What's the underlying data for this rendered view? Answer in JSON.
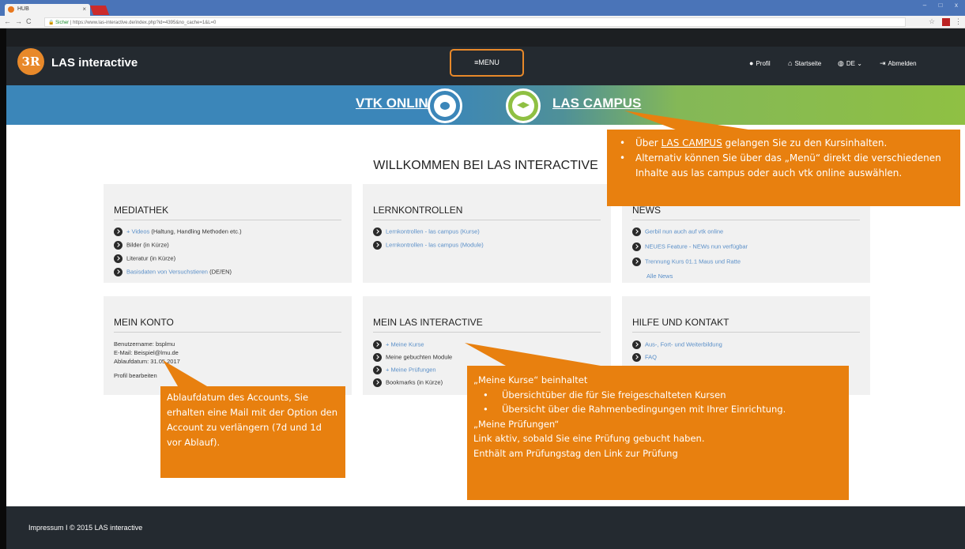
{
  "browser": {
    "tab_title": "HUB",
    "tab_close": "×",
    "url_secure": "Sicher",
    "url": "https://www.las-interactive.de/index.php?id=4395&no_cache=1&L=0",
    "star": "☆",
    "back": "←",
    "forward": "→",
    "reload": "C",
    "kebab": "⋮",
    "win_min": "–",
    "win_max": "□",
    "win_close": "x"
  },
  "header": {
    "logo_text": "3R",
    "brand": "LAS interactive",
    "menu_label": "≡MENU",
    "nav": {
      "profil": "Profil",
      "startseite": "Startseite",
      "lang": "DE",
      "abmelden": "Abmelden"
    }
  },
  "banner": {
    "vtk": "VTK ONLINE",
    "campus": "LAS CAMPUS"
  },
  "welcome": "WILLKOMMEN BEI LAS INTERACTIVE",
  "cards": {
    "mediathek": {
      "title": "MEDIATHEK",
      "items": [
        {
          "link": "+ Videos",
          "rest": " (Haltung, Handling Methoden etc.)"
        },
        {
          "link": "",
          "rest": "Bilder (in Kürze)"
        },
        {
          "link": "",
          "rest": "Literatur (in Kürze)"
        },
        {
          "link": "Basisdaten von Versuchstieren",
          "rest": " (DE/EN)"
        }
      ]
    },
    "lernkontrollen": {
      "title": "LERNKONTROLLEN",
      "items": [
        "Lernkontrollen - las campus (Kurse)",
        "Lernkontrollen - las campus (Module)"
      ]
    },
    "news": {
      "title": "NEWS",
      "items": [
        "Gerbil nun auch auf vtk online",
        "NEUES Feature - NEWs nun verfügbar",
        "Trennung Kurs 01.1 Maus und Ratte"
      ],
      "all": "Alle News"
    },
    "konto": {
      "title": "MEIN KONTO",
      "username": "Benutzername: bsplmu",
      "email": "E-Mail: Beispiel@lmu.de",
      "ablauf": "Ablaufdatum: 31.05.2017",
      "edit": "Profil bearbeiten"
    },
    "mein_las": {
      "title": "MEIN LAS INTERACTIVE",
      "items": [
        {
          "text": "+ Meine Kurse",
          "link": true
        },
        {
          "text": "Meine gebuchten Module",
          "link": false
        },
        {
          "text": "+ Meine Prüfungen",
          "link": true
        },
        {
          "text": "Bookmarks (in Kürze)",
          "link": false
        }
      ]
    },
    "hilfe": {
      "title": "HILFE UND KONTAKT",
      "items": [
        "Aus-, Fort- und Weiterbildung",
        "FAQ"
      ]
    }
  },
  "callouts": {
    "campus": {
      "bullet": "•",
      "line1_pre": "Über ",
      "line1_link": "LAS CAMPUS",
      "line1_post": " gelangen Sie zu den Kursinhalten.",
      "line2": "Alternativ können Sie über das „Menü“ direkt die verschiedenen Inhalte aus las campus oder auch vtk online auswählen."
    },
    "account": "Ablaufdatum des Accounts, Sie erhalten eine Mail mit der Option den Account zu verlängern (7d und 1d vor Ablauf).",
    "kurse": {
      "head_open": "„",
      "head_term": "Meine Kurse",
      "head_close": "“ beinhaltet",
      "bullet": "•",
      "b1": "Übersichtüber die für Sie freigeschalteten Kursen",
      "b2": "Übersicht über die Rahmenbedingungen mit Ihrer Einrichtung.",
      "pruef_open": "„",
      "pruef_term": "Meine Prüfungen",
      "pruef_close": "“",
      "l1": "Link aktiv, sobald Sie eine Prüfung gebucht haben.",
      "l2": "Enthält am Prüfungstag den Link zur Prüfung"
    }
  },
  "footer": "Impressum I © 2015 LAS interactive",
  "colors": {
    "accent": "#e8800f",
    "header_bg": "#242a30",
    "banner_blue": "#3b86b9",
    "banner_green": "#8fc043",
    "link": "#5a8fc8"
  }
}
